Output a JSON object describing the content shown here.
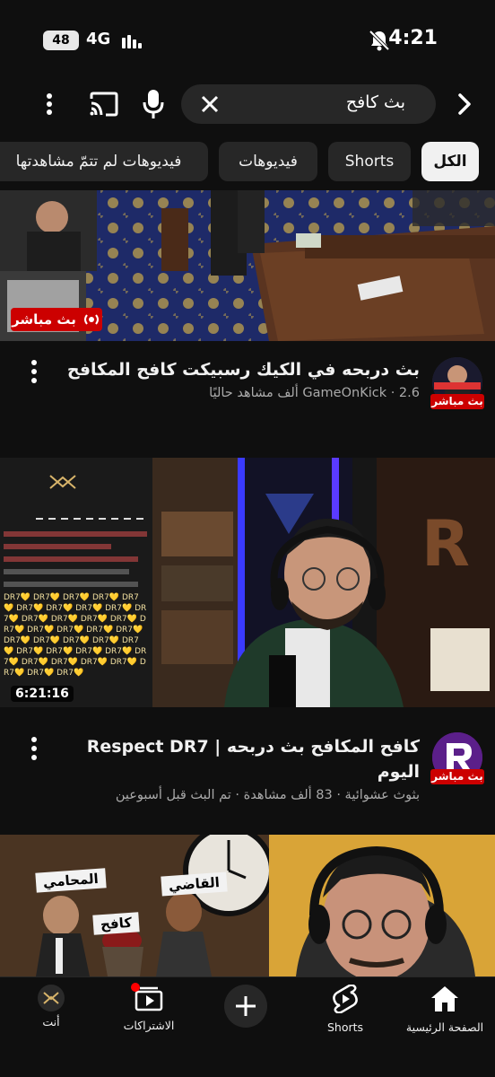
{
  "status_bar": {
    "time": "4:21",
    "battery": "48",
    "network": "4G"
  },
  "search": {
    "query": "بث كافح"
  },
  "chips": [
    {
      "label": "الكل"
    },
    {
      "label": "Shorts"
    },
    {
      "label": "فيديوهات"
    },
    {
      "label": "فيديوهات لم تتمّ مشاهدتها"
    }
  ],
  "videos": [
    {
      "title": "بث دربحه في الكيك رسبيكت كافح المكافح",
      "meta": "GameOnKick · 2.6 ألف مشاهد حاليًا",
      "badge": "بث مباشر",
      "avatar_badge": "بث مباشر",
      "avatar_text": "GAMEONKICK"
    },
    {
      "title_line1": "كافح المكافح بث دربحه  | Respect DR7",
      "title_line2": "اليوم",
      "meta": "بثوث عشوائية · 83 ألف مشاهدة · تم البث قبل أسبوعين",
      "duration": "6:21:16",
      "avatar_badge": "بث مباشر",
      "chat_repeat": "DR7"
    },
    {
      "labels": [
        "المحامي",
        "القاضي",
        "كافح"
      ]
    }
  ],
  "bottom_nav": [
    {
      "label": "الصفحة الرئيسية",
      "icon": "home-icon"
    },
    {
      "label": "Shorts",
      "icon": "shorts-icon"
    },
    {
      "label": "",
      "icon": "create-plus-icon"
    },
    {
      "label": "الاشتراكات",
      "icon": "subscriptions-icon"
    },
    {
      "label": "أنت",
      "icon": "you-avatar-icon"
    }
  ],
  "colors": {
    "background": "#0f0f0f",
    "chip": "#272727",
    "live_red": "#cc0000",
    "text": "#f1f1f1",
    "meta": "#aaaaaa"
  }
}
